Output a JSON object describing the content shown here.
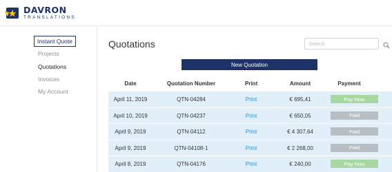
{
  "brand": {
    "name": "DAVRON",
    "sub": "TRANSLATIONS",
    "colors": {
      "navy": "#1d3266",
      "yellow": "#f4c21b"
    }
  },
  "sidebar": {
    "items": [
      {
        "label": "Instant Quote",
        "state": "outlined"
      },
      {
        "label": "Projects",
        "state": "inactive"
      },
      {
        "label": "Quotations",
        "state": "active"
      },
      {
        "label": "Invoices",
        "state": "inactive"
      },
      {
        "label": "My Account",
        "state": "inactive"
      }
    ]
  },
  "main": {
    "title": "Quotations",
    "search": {
      "placeholder": "Search",
      "icon": "search-icon"
    },
    "new_button": "New Quotation",
    "table": {
      "headers": [
        "Date",
        "Quotation Number",
        "Print",
        "Amount",
        "Payment"
      ],
      "rows": [
        {
          "date": "April 11, 2019",
          "number": "QTN-04284",
          "print": "Print",
          "amount": "€ 695,41",
          "payment": "Pay Now",
          "status": "pay"
        },
        {
          "date": "April 10, 2019",
          "number": "QTN-04237",
          "print": "Print",
          "amount": "€ 650,05",
          "payment": "Paid",
          "status": "paid"
        },
        {
          "date": "April 9, 2019",
          "number": "QTN-04112",
          "print": "Print",
          "amount": "€ 4 307,64",
          "payment": "Paid",
          "status": "paid"
        },
        {
          "date": "April 9, 2019",
          "number": "QTN-04108-1",
          "print": "Print",
          "amount": "€ 2 268,00",
          "payment": "Paid",
          "status": "paid"
        },
        {
          "date": "April 8, 2019",
          "number": "QTN-04176",
          "print": "Print",
          "amount": "€ 240,00",
          "payment": "Pay Now",
          "status": "pay"
        }
      ]
    }
  }
}
